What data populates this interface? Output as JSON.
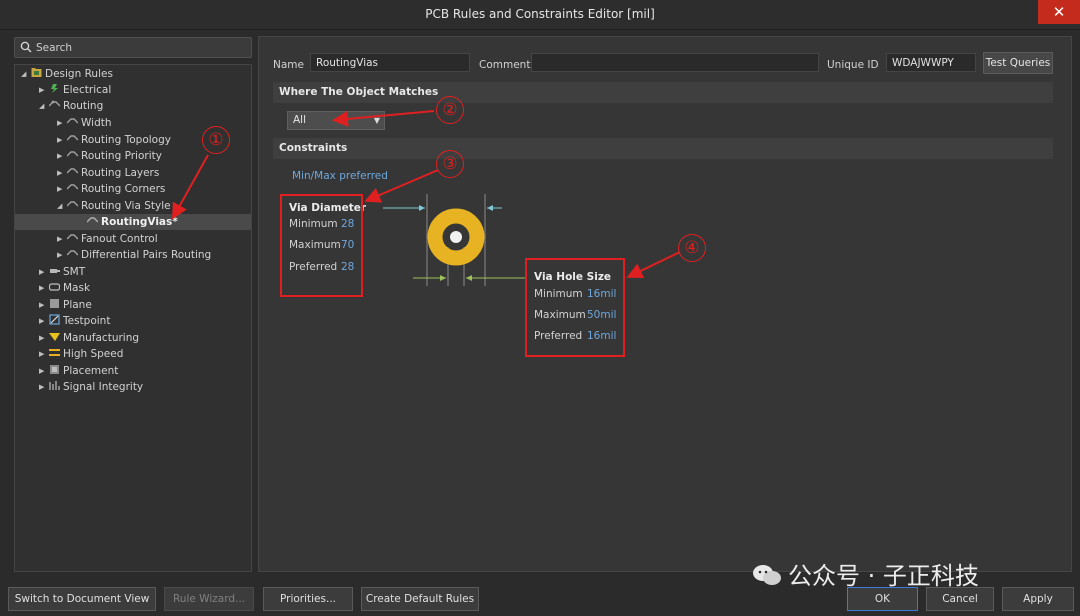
{
  "window": {
    "title": "PCB Rules and Constraints Editor [mil]",
    "close_glyph": "✕"
  },
  "search": {
    "placeholder": "Search"
  },
  "tree": {
    "root": "Design Rules",
    "categories": {
      "electrical": "Electrical",
      "routing": "Routing",
      "smt": "SMT",
      "mask": "Mask",
      "plane": "Plane",
      "testpoint": "Testpoint",
      "manufacturing": "Manufacturing",
      "high_speed": "High Speed",
      "placement": "Placement",
      "signal_integrity": "Signal Integrity"
    },
    "routing_children": {
      "width": "Width",
      "topology": "Routing Topology",
      "priority": "Routing Priority",
      "layers": "Routing Layers",
      "corners": "Routing Corners",
      "via_style": "Routing Via Style",
      "fanout": "Fanout Control",
      "diff_pairs": "Differential Pairs Routing"
    },
    "selected_rule": "RoutingVias*"
  },
  "rule_header": {
    "name_label": "Name",
    "name_value": "RoutingVias",
    "comment_label": "Comment",
    "comment_value": "",
    "unique_id_label": "Unique ID",
    "unique_id_value": "WDAJWWPY",
    "test_queries": "Test Queries"
  },
  "where": {
    "section_title": "Where The Object Matches",
    "scope_value": "All"
  },
  "constraints": {
    "section_title": "Constraints",
    "mode": "Min/Max preferred",
    "via_diameter": {
      "title": "Via Diameter",
      "minimum_label": "Minimum",
      "minimum_value": "28",
      "maximum_label": "Maximum",
      "maximum_value": "70",
      "preferred_label": "Preferred",
      "preferred_value": "28"
    },
    "via_hole": {
      "title": "Via Hole Size",
      "minimum_label": "Minimum",
      "minimum_value": "16mil",
      "maximum_label": "Maximum",
      "maximum_value": "50mil",
      "preferred_label": "Preferred",
      "preferred_value": "16mil"
    }
  },
  "annotations": {
    "one": "①",
    "two": "②",
    "three": "③",
    "four": "④"
  },
  "footer": {
    "switch_view": "Switch to Document View",
    "rule_wizard": "Rule Wizard...",
    "priorities": "Priorities...",
    "create_default": "Create Default Rules",
    "ok": "OK",
    "cancel": "Cancel",
    "apply": "Apply"
  },
  "watermark": "公众号 · 子正科技",
  "colors": {
    "via_ring": "#e8b322",
    "annotation": "#e02020",
    "value_text": "#6fa8dc",
    "dimension_line": "#7ec8d8",
    "hole_dimension_line": "#9cc05a"
  }
}
